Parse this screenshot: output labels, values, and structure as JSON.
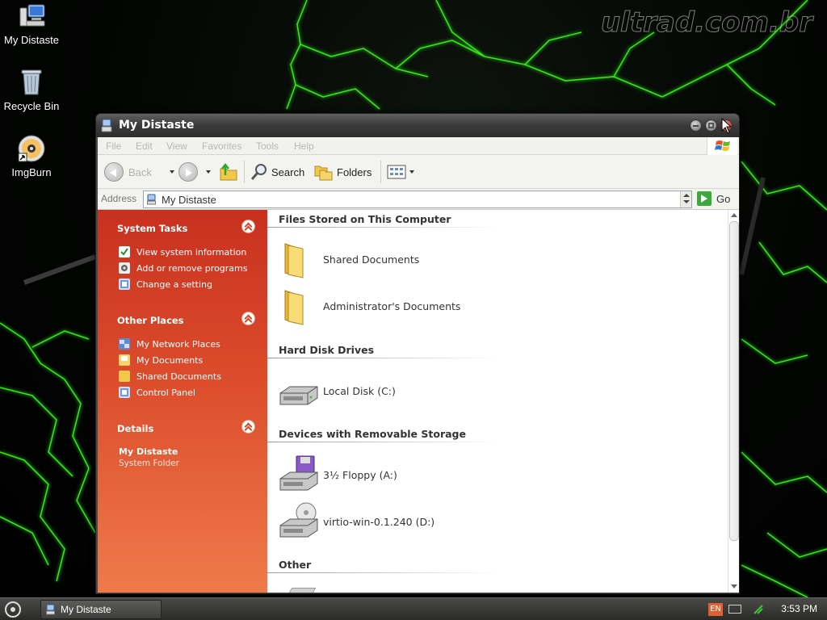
{
  "desktop": {
    "watermark": "ultrad.com.br",
    "icons": [
      {
        "label": "My Distaste",
        "icon": "computer-icon"
      },
      {
        "label": "Recycle Bin",
        "icon": "recycle-bin-icon"
      },
      {
        "label": "ImgBurn",
        "icon": "disc-icon"
      }
    ]
  },
  "window": {
    "title": "My Distaste",
    "menu": [
      "File",
      "Edit",
      "View",
      "Favorites",
      "Tools",
      "Help"
    ],
    "toolbar": {
      "back_label": "Back",
      "search_label": "Search",
      "folders_label": "Folders"
    },
    "address": {
      "label": "Address",
      "value": "My Distaste",
      "go_label": "Go"
    },
    "taskpane": {
      "system_tasks": {
        "title": "System Tasks",
        "items": [
          "View system information",
          "Add or remove programs",
          "Change a setting"
        ]
      },
      "other_places": {
        "title": "Other Places",
        "items": [
          "My Network Places",
          "My Documents",
          "Shared Documents",
          "Control Panel"
        ]
      },
      "details": {
        "title": "Details",
        "name": "My Distaste",
        "type": "System Folder"
      }
    },
    "content": {
      "groups": [
        {
          "title": "Files Stored on This Computer",
          "items": [
            "Shared Documents",
            "Administrator's Documents"
          ]
        },
        {
          "title": "Hard Disk Drives",
          "items": [
            "Local Disk (C:)"
          ]
        },
        {
          "title": "Devices with Removable Storage",
          "items": [
            "3½ Floppy (A:)",
            "virtio-win-0.1.240 (D:)"
          ]
        },
        {
          "title": "Other",
          "items": []
        }
      ]
    }
  },
  "taskbar": {
    "task_label": "My Distaste",
    "language": "EN",
    "clock": "3:53 PM"
  },
  "colors": {
    "taskpane_top": "#c8301f",
    "taskpane_bottom": "#ef7a4a",
    "lightning": "#39ff14"
  }
}
